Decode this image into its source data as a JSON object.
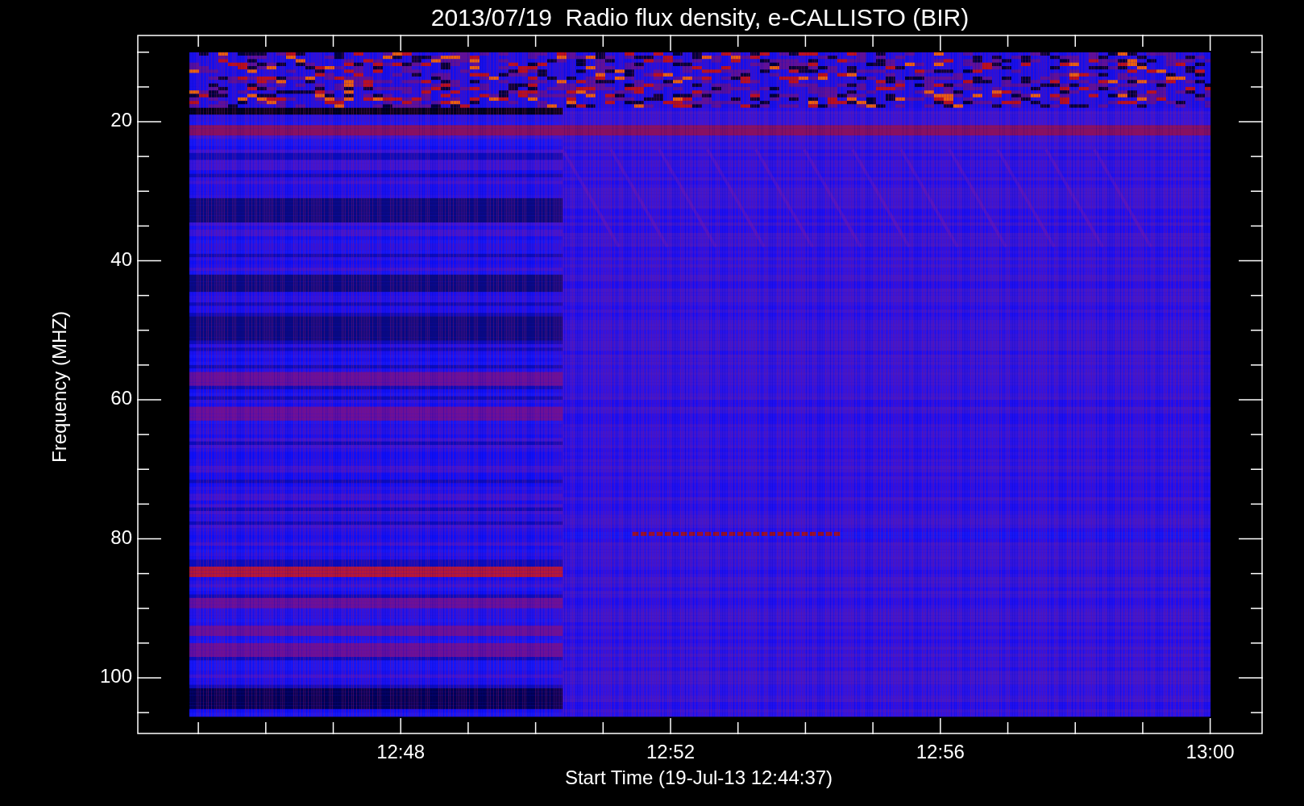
{
  "plot": {
    "title": "2013/07/19  Radio flux density, e-CALLISTO (BIR)",
    "ylabel": "Frequency (MHZ)",
    "xlabel": "Start Time (19-Jul-13 12:44:37)",
    "ytick_labels": [
      "20",
      "40",
      "60",
      "80",
      "100"
    ],
    "xtick_labels": [
      "12:48",
      "12:52",
      "12:56",
      "13:00"
    ]
  }
}
